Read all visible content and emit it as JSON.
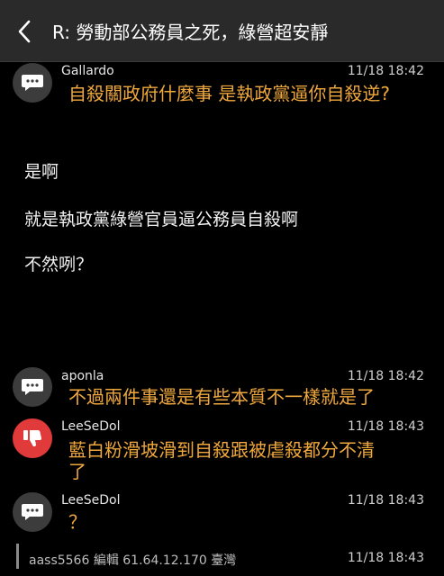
{
  "header": {
    "title": "R: 勞動部公務員之死，綠營超安靜"
  },
  "posts": [
    {
      "user": "Gallardo",
      "time": "11/18 18:42",
      "text": "自殺關政府什麼事 是執政黨逼你自殺逆?",
      "avatar": "chat-bubble-icon"
    },
    {
      "user": "aponla",
      "time": "11/18 18:42",
      "text": "不過兩件事還是有些本質不一樣就是了",
      "avatar": "chat-bubble-icon"
    },
    {
      "user": "LeeSeDol",
      "time": "11/18 18:43",
      "text_line1": "藍白粉滑坡滑到自殺跟被虐殺都分不清",
      "text_line2": "了",
      "avatar": "thumbs-down-icon"
    },
    {
      "user": "LeeSeDol",
      "time": "11/18 18:43",
      "text": "？",
      "avatar": "chat-bubble-icon"
    }
  ],
  "body": {
    "line1": "是啊",
    "line2": "就是執政黨綠營官員逼公務員自殺啊",
    "line3": "不然咧？"
  },
  "footer": {
    "text": "aass5566 編輯 61.64.12.170 臺灣",
    "time": "11/18 18:43"
  },
  "colors": {
    "push": "#f0a83c",
    "downvote": "#e03a3a",
    "header_bg": "#2a2a2a"
  }
}
